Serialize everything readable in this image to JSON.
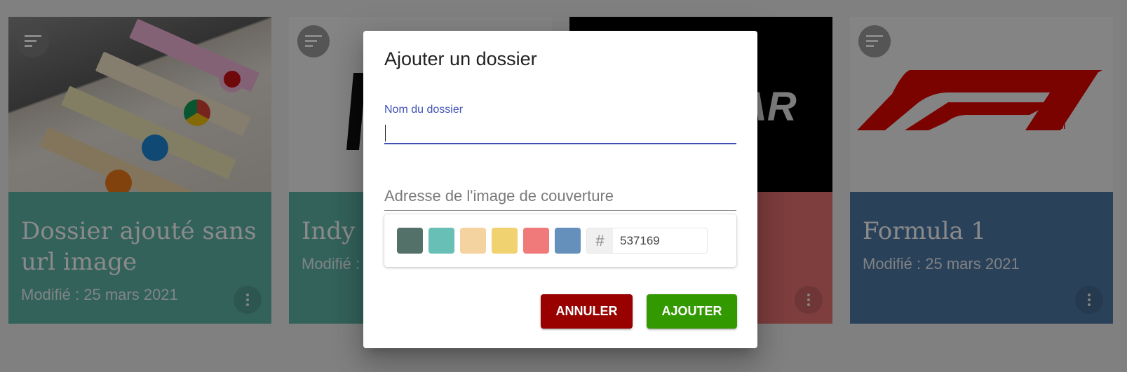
{
  "cards": [
    {
      "title": "Dossier ajouté sans url image",
      "modified": "Modifié : 25 mars 2021",
      "color": "#5fb5a9"
    },
    {
      "title": "Indy c",
      "modified": "Modifié :",
      "color": "#5fb5a9"
    },
    {
      "title": "",
      "modified": "",
      "color": "#e77472",
      "image_text": "AR"
    },
    {
      "title": "Formula 1",
      "modified": "Modifié : 25 mars 2021",
      "color": "#4f79a7"
    }
  ],
  "dialog": {
    "title": "Ajouter un dossier",
    "name_label": "Nom du dossier",
    "name_value": "",
    "url_placeholder": "Adresse de l'image de couverture",
    "swatches": [
      "#537169",
      "#67bfb6",
      "#f5d3a0",
      "#f0d270",
      "#f07a7a",
      "#6590bb"
    ],
    "hex_symbol": "#",
    "hex_value": "537169",
    "cancel_label": "ANNULER",
    "add_label": "AJOUTER"
  },
  "colors": {
    "accent": "#3f51b5",
    "cancel": "#990000",
    "add": "#339900"
  }
}
